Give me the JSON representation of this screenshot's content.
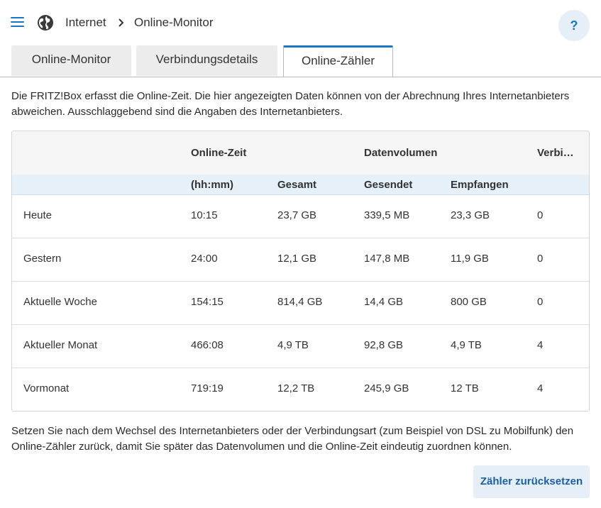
{
  "breadcrumb": {
    "section": "Internet",
    "page": "Online-Monitor"
  },
  "help": {
    "label": "?"
  },
  "tabs": [
    {
      "label": "Online-Monitor",
      "active": false
    },
    {
      "label": "Verbindungsdetails",
      "active": false
    },
    {
      "label": "Online-Zähler",
      "active": true
    }
  ],
  "intro": "Die FRITZ!Box erfasst die Online-Zeit. Die hier angezeigten Daten können von der Abrechnung Ihres Internetanbieters abweichen. Ausschlaggebend sind die Angaben des Internetanbieters.",
  "table": {
    "header1": {
      "online_time": "Online-Zeit",
      "data_volume": "Datenvolumen",
      "connections": "Verbi…"
    },
    "header2": {
      "unit": "(hh:mm)",
      "total": "Gesamt",
      "sent": "Gesendet",
      "received": "Empfangen"
    },
    "rows": [
      {
        "period": "Heute",
        "time": "10:15",
        "total": "23,7 GB",
        "sent": "339,5 MB",
        "received": "23,3 GB",
        "connections": "0"
      },
      {
        "period": "Gestern",
        "time": "24:00",
        "total": "12,1 GB",
        "sent": "147,8 MB",
        "received": "11,9 GB",
        "connections": "0"
      },
      {
        "period": "Aktuelle Woche",
        "time": "154:15",
        "total": "814,4 GB",
        "sent": "14,4 GB",
        "received": "800 GB",
        "connections": "0"
      },
      {
        "period": "Aktueller Monat",
        "time": "466:08",
        "total": "4,9 TB",
        "sent": "92,8 GB",
        "received": "4,9 TB",
        "connections": "4"
      },
      {
        "period": "Vormonat",
        "time": "719:19",
        "total": "12,2 TB",
        "sent": "245,9 GB",
        "received": "12 TB",
        "connections": "4"
      }
    ]
  },
  "footer_text": "Setzen Sie nach dem Wechsel des Internetanbieters oder der Verbindungsart (zum Beispiel von DSL zu Mobilfunk) den Online-Zähler zurück, damit Sie später das Datenvolumen und die Online-Zeit eindeutig zuordnen können.",
  "reset_button": "Zähler zurücksetzen",
  "colors": {
    "accent": "#1a76c6",
    "header_blue": "#e5f0f9",
    "button_bg": "#e6eff8"
  }
}
